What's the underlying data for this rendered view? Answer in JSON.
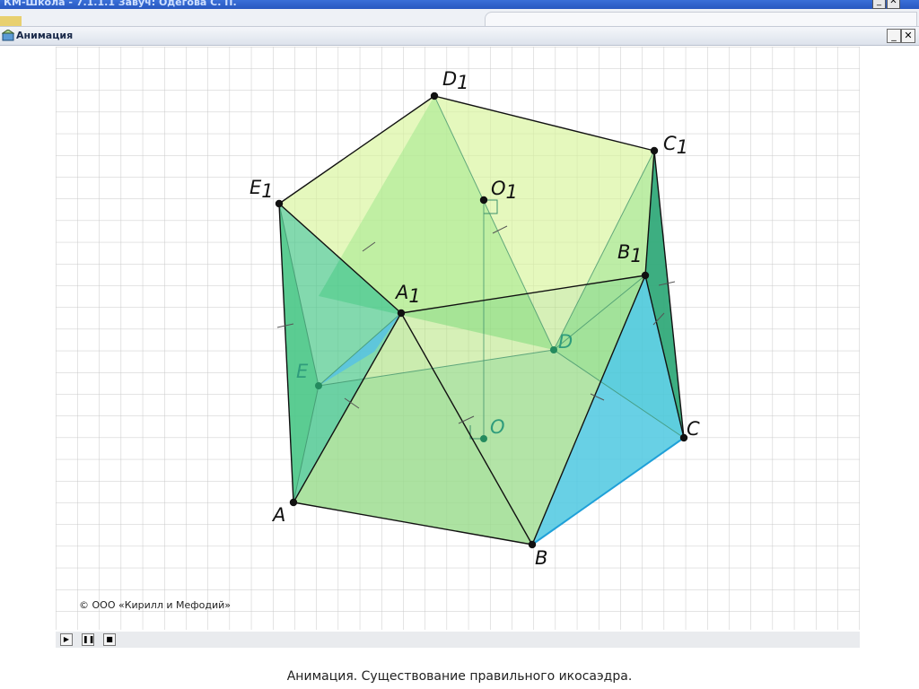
{
  "outer_window": {
    "title": "КМ-Школа - 7.1.1.1 Завуч: Одегова С. П.",
    "minimize": "_",
    "close": "✕"
  },
  "window": {
    "title": "Анимация",
    "icon": "animation-window-icon",
    "minimize": "_",
    "close": "✕"
  },
  "figure": {
    "vertices": {
      "A": {
        "letter": "A",
        "sub": ""
      },
      "B": {
        "letter": "B",
        "sub": ""
      },
      "C": {
        "letter": "C",
        "sub": ""
      },
      "D": {
        "letter": "D",
        "sub": ""
      },
      "E": {
        "letter": "E",
        "sub": ""
      },
      "O": {
        "letter": "O",
        "sub": ""
      },
      "A1": {
        "letter": "A",
        "sub": "1"
      },
      "B1": {
        "letter": "B",
        "sub": "1"
      },
      "C1": {
        "letter": "C",
        "sub": "1"
      },
      "D1": {
        "letter": "D",
        "sub": "1"
      },
      "E1": {
        "letter": "E",
        "sub": "1"
      },
      "O1": {
        "letter": "O",
        "sub": "1"
      }
    }
  },
  "copyright": "© ООО «Кирилл и Мефодий»",
  "controls": {
    "play_icon": "play-icon",
    "pause_icon": "pause-icon",
    "stop_icon": "stop-icon",
    "play": "▶",
    "pause": "❚❚",
    "stop": "■"
  },
  "caption": "Анимация. Существование правильного икосаэдра."
}
